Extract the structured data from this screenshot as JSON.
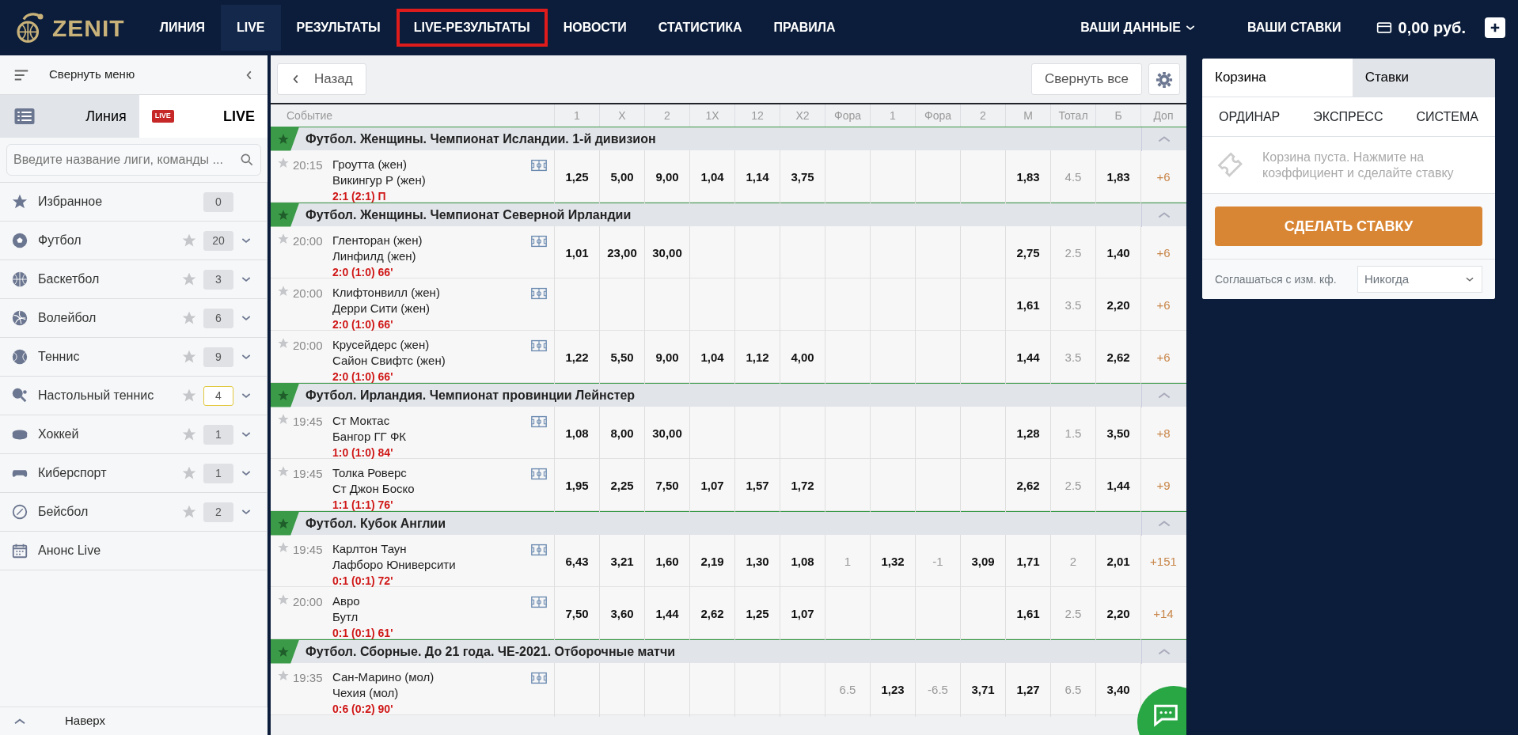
{
  "header": {
    "logo": "ZENIT",
    "nav": [
      {
        "label": "ЛИНИЯ",
        "selected": false,
        "outlined": false
      },
      {
        "label": "LIVE",
        "selected": true,
        "outlined": false
      },
      {
        "label": "РЕЗУЛЬТАТЫ",
        "selected": false,
        "outlined": false
      },
      {
        "label": "LIVE-РЕЗУЛЬТАТЫ",
        "selected": false,
        "outlined": true
      },
      {
        "label": "НОВОСТИ",
        "selected": false,
        "outlined": false
      },
      {
        "label": "СТАТИСТИКА",
        "selected": false,
        "outlined": false
      },
      {
        "label": "ПРАВИЛА",
        "selected": false,
        "outlined": false
      }
    ],
    "account": "ВАШИ ДАННЫЕ",
    "my_bets": "ВАШИ СТАВКИ",
    "balance": "0,00 руб."
  },
  "sidebar": {
    "collapse": "Свернуть меню",
    "tabs": [
      {
        "label": "Линия",
        "selected": false
      },
      {
        "label": "LIVE",
        "badge": "LIVE",
        "selected": true
      }
    ],
    "search": {
      "placeholder": "Введите название лиги, команды ..."
    },
    "items": [
      {
        "kind": "favorites",
        "name": "Избранное",
        "count": "0",
        "highlight": false
      },
      {
        "kind": "sport",
        "name": "Футбол",
        "count": "20",
        "highlight": false
      },
      {
        "kind": "sport",
        "name": "Баскетбол",
        "count": "3",
        "highlight": false
      },
      {
        "kind": "sport",
        "name": "Волейбол",
        "count": "6",
        "highlight": false
      },
      {
        "kind": "sport",
        "name": "Теннис",
        "count": "9",
        "highlight": false
      },
      {
        "kind": "sport",
        "name": "Настольный теннис",
        "count": "4",
        "highlight": true
      },
      {
        "kind": "sport",
        "name": "Хоккей",
        "count": "1",
        "highlight": false
      },
      {
        "kind": "sport",
        "name": "Киберспорт",
        "count": "1",
        "highlight": false
      },
      {
        "kind": "sport",
        "name": "Бейсбол",
        "count": "2",
        "highlight": false
      },
      {
        "kind": "link",
        "name": "Анонс Live"
      }
    ],
    "to_top": "Наверх"
  },
  "toolbar": {
    "back": "Назад",
    "collapse_all": "Свернуть все"
  },
  "table": {
    "columns": [
      {
        "label": "Событие",
        "kind": "event"
      },
      {
        "label": "1",
        "kind": "odd"
      },
      {
        "label": "X",
        "kind": "odd"
      },
      {
        "label": "2",
        "kind": "odd"
      },
      {
        "label": "1X",
        "kind": "odd"
      },
      {
        "label": "12",
        "kind": "odd"
      },
      {
        "label": "X2",
        "kind": "odd"
      },
      {
        "label": "Фора",
        "kind": "param"
      },
      {
        "label": "1",
        "kind": "odd"
      },
      {
        "label": "Фора",
        "kind": "param"
      },
      {
        "label": "2",
        "kind": "odd"
      },
      {
        "label": "М",
        "kind": "odd"
      },
      {
        "label": "Тотал",
        "kind": "param"
      },
      {
        "label": "Б",
        "kind": "odd"
      },
      {
        "label": "Доп",
        "kind": "more"
      }
    ],
    "groups": [
      {
        "title": "Футбол. Женщины. Чемпионат Исландии. 1-й дивизион",
        "matches": [
          {
            "time": "20:15",
            "team1": "Гроутта (жен)",
            "team2": "Викингур Р (жен)",
            "score": "2:1 (2:1) П",
            "odds": {
              "w1": "1,25",
              "draw": "5,00",
              "w2": "9,00",
              "w1_or_draw": "1,04",
              "w1_or_w2": "1,14",
              "draw_or_w2": "3,75",
              "under": "1,83",
              "total": "4.5",
              "over": "1,83",
              "extra": "+6"
            }
          }
        ]
      },
      {
        "title": "Футбол. Женщины. Чемпионат Северной Ирландии",
        "matches": [
          {
            "time": "20:00",
            "team1": "Гленторан (жен)",
            "team2": "Линфилд (жен)",
            "score": "2:0 (1:0) 66'",
            "odds": {
              "w1": "1,01",
              "draw": "23,00",
              "w2": "30,00",
              "under": "2,75",
              "total": "2.5",
              "over": "1,40",
              "extra": "+6"
            }
          },
          {
            "time": "20:00",
            "team1": "Клифтонвилл (жен)",
            "team2": "Дерри Сити (жен)",
            "score": "2:0 (1:0) 66'",
            "odds": {
              "under": "1,61",
              "total": "3.5",
              "over": "2,20",
              "extra": "+6"
            }
          },
          {
            "time": "20:00",
            "team1": "Крусейдерс (жен)",
            "team2": "Сайон Свифтс (жен)",
            "score": "2:0 (1:0) 66'",
            "odds": {
              "w1": "1,22",
              "draw": "5,50",
              "w2": "9,00",
              "w1_or_draw": "1,04",
              "w1_or_w2": "1,12",
              "draw_or_w2": "4,00",
              "under": "1,44",
              "total": "3.5",
              "over": "2,62",
              "extra": "+6"
            }
          }
        ]
      },
      {
        "title": "Футбол. Ирландия. Чемпионат провинции Лейнстер",
        "matches": [
          {
            "time": "19:45",
            "team1": "Ст Моктас",
            "team2": "Бангор ГГ ФК",
            "score": "1:0 (1:0) 84'",
            "odds": {
              "w1": "1,08",
              "draw": "8,00",
              "w2": "30,00",
              "under": "1,28",
              "total": "1.5",
              "over": "3,50",
              "extra": "+8"
            }
          },
          {
            "time": "19:45",
            "team1": "Толка Роверс",
            "team2": "Ст Джон Боско",
            "score": "1:1 (1:1) 76'",
            "odds": {
              "w1": "1,95",
              "draw": "2,25",
              "w2": "7,50",
              "w1_or_draw": "1,07",
              "w1_or_w2": "1,57",
              "draw_or_w2": "1,72",
              "under": "2,62",
              "total": "2.5",
              "over": "1,44",
              "extra": "+9"
            }
          }
        ]
      },
      {
        "title": "Футбол. Кубок Англии",
        "matches": [
          {
            "time": "19:45",
            "team1": "Карлтон Таун",
            "team2": "Лафборо Юниверсити",
            "score": "0:1 (0:1) 72'",
            "odds": {
              "w1": "6,43",
              "draw": "3,21",
              "w2": "1,60",
              "w1_or_draw": "2,19",
              "w1_or_w2": "1,30",
              "draw_or_w2": "1,08",
              "handicap_1": "1",
              "handicap_1_odds": "1,32",
              "handicap_2": "-1",
              "handicap_2_odds": "3,09",
              "under": "1,71",
              "total": "2",
              "over": "2,01",
              "extra": "+151"
            }
          },
          {
            "time": "20:00",
            "team1": "Авро",
            "team2": "Бутл",
            "score": "0:1 (0:1) 61'",
            "odds": {
              "w1": "7,50",
              "draw": "3,60",
              "w2": "1,44",
              "w1_or_draw": "2,62",
              "w1_or_w2": "1,25",
              "draw_or_w2": "1,07",
              "under": "1,61",
              "total": "2.5",
              "over": "2,20",
              "extra": "+14"
            }
          }
        ]
      },
      {
        "title": "Футбол. Сборные. До 21 года. ЧЕ-2021. Отборочные матчи",
        "matches": [
          {
            "time": "19:35",
            "team1": "Сан-Марино (мол)",
            "team2": "Чехия (мол)",
            "score": "0:6 (0:2) 90'",
            "odds": {
              "handicap_1": "6.5",
              "handicap_1_odds": "1,23",
              "handicap_2": "-6.5",
              "handicap_2_odds": "3,71",
              "under": "1,27",
              "total": "6.5",
              "over": "3,40"
            }
          }
        ]
      }
    ]
  },
  "betslip": {
    "tabs": [
      {
        "label": "Корзина",
        "selected": true
      },
      {
        "label": "Ставки",
        "selected": false
      }
    ],
    "types": [
      "ОРДИНАР",
      "ЭКСПРЕСС",
      "СИСТЕМА"
    ],
    "empty": "Корзина пуста. Нажмите на коэффициент и сделайте ставку",
    "submit": "СДЕЛАТЬ СТАВКУ",
    "accept_label": "Соглашаться с изм. кф.",
    "accept_value": "Никогда"
  }
}
